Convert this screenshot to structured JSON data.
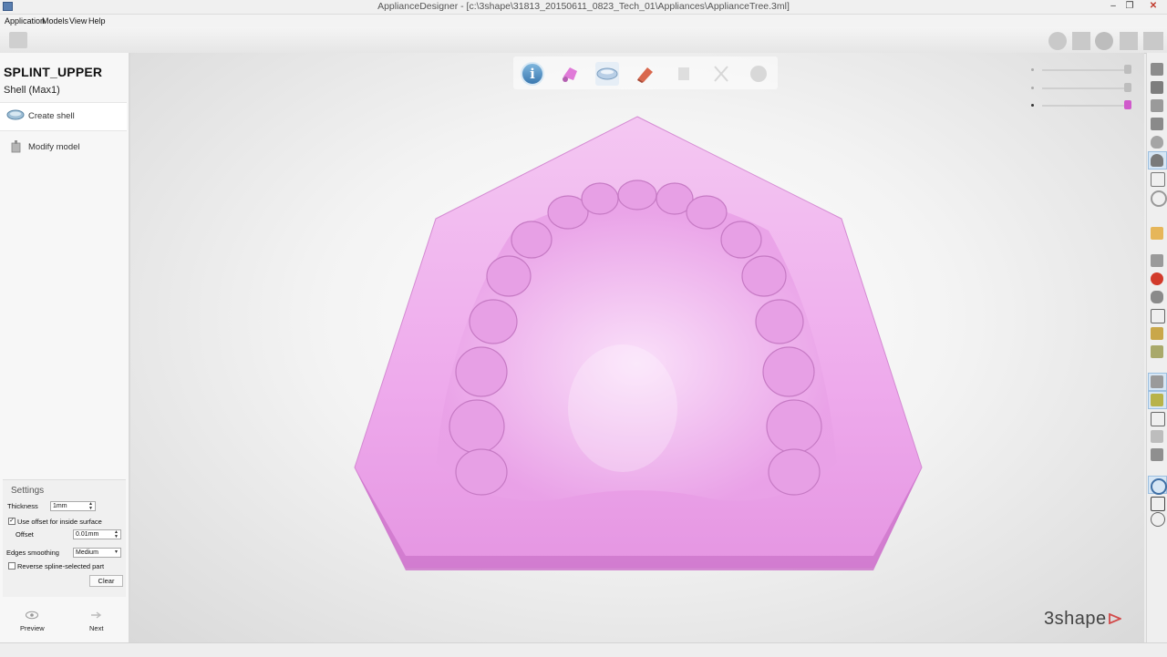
{
  "window": {
    "title": "ApplianceDesigner - [c:\\3shape\\31813_20150611_0823_Tech_01\\Appliances\\ApplianceTree.3ml]",
    "minimize": "–",
    "maximize": "❐",
    "close": "✕"
  },
  "menu": {
    "items": [
      {
        "label": "Application"
      },
      {
        "label": "Models"
      },
      {
        "label": "View"
      },
      {
        "label": "Help"
      }
    ]
  },
  "left_panel": {
    "title": "SPLINT_UPPER",
    "subtitle": "Shell (Max1)",
    "steps": [
      {
        "label": "Create shell",
        "icon": "shell-icon",
        "active": true
      },
      {
        "label": "Modify model",
        "icon": "modify-model-icon",
        "active": false
      }
    ],
    "settings": {
      "title": "Settings",
      "thickness_label": "Thickness",
      "thickness_value": "1mm",
      "use_offset_label": "Use offset for inside surface",
      "use_offset_checked": true,
      "offset_label": "Offset",
      "offset_value": "0.01mm",
      "edges_smoothing_label": "Edges smoothing",
      "edges_smoothing_value": "Medium",
      "reverse_label": "Reverse spline-selected part",
      "reverse_checked": false,
      "clear_label": "Clear"
    },
    "nav": {
      "preview_label": "Preview",
      "next_label": "Next"
    }
  },
  "workflow_icons": [
    "info-icon",
    "scan-tooth-icon",
    "shell-icon",
    "eraser-icon",
    "modify-icon",
    "cancel-icon",
    "sphere-icon"
  ],
  "viewport": {
    "model_color": "#e8a6e6",
    "brand": "3shape"
  },
  "transparency_sliders": [
    {
      "name": "slider-1",
      "level": 1.0
    },
    {
      "name": "slider-2",
      "level": 1.0
    },
    {
      "name": "slider-3",
      "level": 1.0
    }
  ]
}
